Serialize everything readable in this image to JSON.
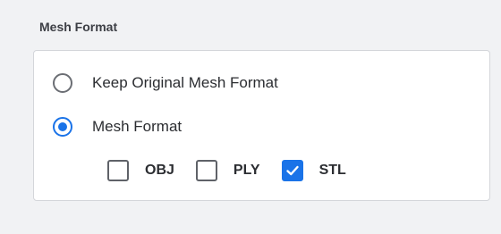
{
  "section": {
    "title": "Mesh Format"
  },
  "options": {
    "keep_original": {
      "label": "Keep Original Mesh Format",
      "selected": false
    },
    "mesh_format": {
      "label": "Mesh Format",
      "selected": true
    }
  },
  "formats": [
    {
      "label": "OBJ",
      "checked": false
    },
    {
      "label": "PLY",
      "checked": false
    },
    {
      "label": "STL",
      "checked": true
    }
  ],
  "colors": {
    "accent": "#1a73e8",
    "background": "#f1f2f4",
    "card": "#ffffff"
  }
}
